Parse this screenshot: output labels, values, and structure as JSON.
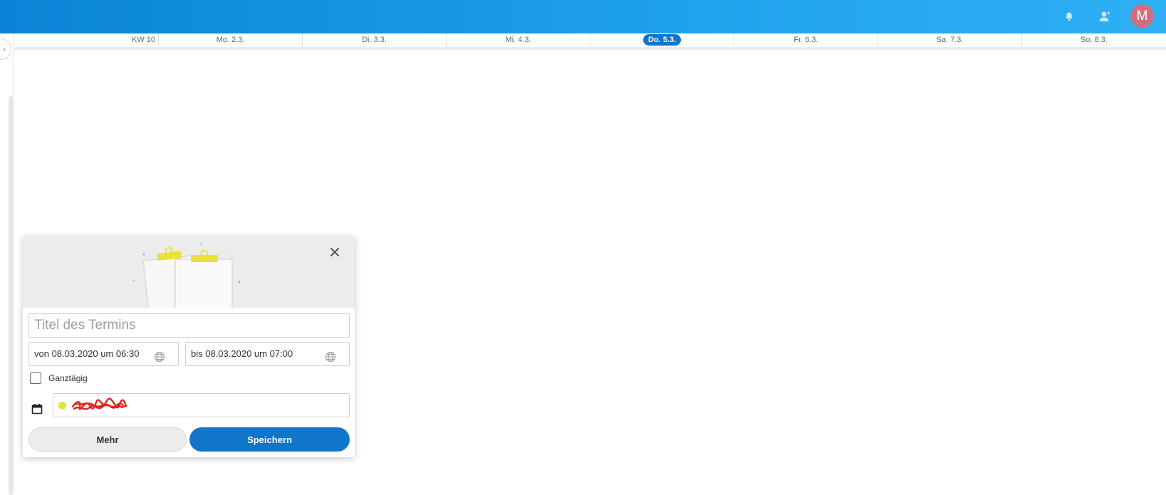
{
  "header": {
    "notifications_icon": "bell-icon",
    "contacts_icon": "person-add-icon",
    "avatar_initial": "M",
    "avatar_color": "#cf6f7d",
    "bar_color": "#1a96e4"
  },
  "week": {
    "label": "KW 10",
    "days": [
      {
        "label": "Mo. 2.3.",
        "today": false
      },
      {
        "label": "Di. 3.3.",
        "today": false
      },
      {
        "label": "Mi. 4.3.",
        "today": false
      },
      {
        "label": "Do. 5.3.",
        "today": true
      },
      {
        "label": "Fr. 6.3.",
        "today": false
      },
      {
        "label": "Sa. 7.3.",
        "today": false
      },
      {
        "label": "So. 8.3.",
        "today": false
      }
    ]
  },
  "event_popup": {
    "title_placeholder": "Titel des Termins",
    "title_value": "",
    "start": "von 08.03.2020 um 06:30",
    "end": "bis 08.03.2020 um 07:00",
    "all_day_label": "Ganztägig",
    "all_day_checked": false,
    "calendar_color": "#e6e233",
    "more_label": "Mehr",
    "save_label": "Speichern",
    "save_color": "#1176c9"
  }
}
